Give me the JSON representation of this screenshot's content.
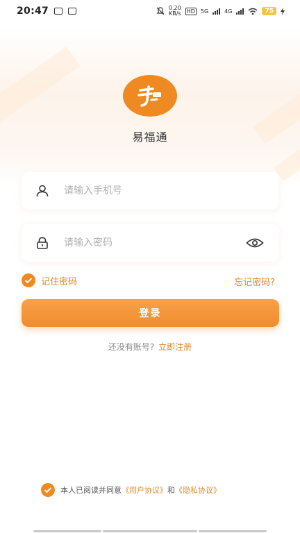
{
  "status_bar": {
    "time": "20:47",
    "net_speed_value": "0.20",
    "net_speed_unit": "KB/s",
    "hd_label": "HD",
    "sig1_label": "5G",
    "sig2_label": "4G",
    "battery": "75"
  },
  "app": {
    "name": "易福通",
    "accent_color": "#ef8a22"
  },
  "login_form": {
    "phone_placeholder": "请输入手机号",
    "password_placeholder": "请输入密码",
    "remember_label": "记住密码",
    "forgot_label": "忘记密码?",
    "login_label": "登录",
    "no_account_text": "还没有账号?",
    "signup_label": "立即注册"
  },
  "agreement": {
    "prefix": "本人已阅读并同意",
    "user_agreement": "《用户协议》",
    "conjunction": "和",
    "privacy_agreement": "《隐私协议》"
  }
}
